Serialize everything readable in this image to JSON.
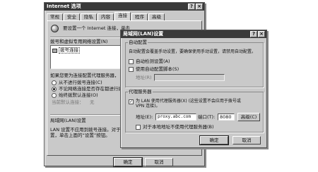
{
  "back_dialog": {
    "title": "Internet 选项",
    "tabs": [
      "常规",
      "安全",
      "隐私",
      "内容",
      "连接",
      "程序",
      "高级"
    ],
    "setup_text": "要设置一个 Internet 连接，单击",
    "dialup_heading": "拨号和虚拟专用网络设置(N)",
    "list_item": "拨号连接",
    "proxy_text_1": "如果您要为连接配置代理服务器，",
    "radio_never": "从不进行拨号连接(C)",
    "radio_no_network": "不论网络连接是否存在都进行拨号(W)",
    "radio_always": "始终拨默认连接(O)",
    "current_default_label": "当前默认连接：",
    "current_default_value": "无",
    "lan_heading": "局域网(LAN)设置",
    "lan_text_1": "LAN 设置不应用到拨号连接。对于",
    "lan_text_2": "置，单击上面的“设置”按钮。",
    "ok": "确定",
    "cancel": "取消"
  },
  "lan_dialog": {
    "title": "局域网(LAN)设置",
    "auto_group": "自动配置",
    "auto_desc": "自动配置会覆盖手动设置，要确保使用手动设置，请禁用自动配置。",
    "auto_detect": "自动检测设置(A)",
    "auto_script": "使用自动配置脚本(S)",
    "address_label_disabled": "地址(R)",
    "proxy_group": "代理服务器",
    "use_proxy_line1": "为 LAN 使用代理服务器(X) (这些设置不会应用于拨号或",
    "use_proxy_line2": "VPN 连接)。",
    "use_proxy_checked": true,
    "address_label": "地址(E):",
    "address_value": "proxy.abc.com",
    "port_label": "端口(T):",
    "port_value": "8080",
    "advanced": "高级(C)",
    "bypass_local": "对于本地地址不使用代理服务器(B)",
    "ok": "确定",
    "cancel": "取消"
  }
}
